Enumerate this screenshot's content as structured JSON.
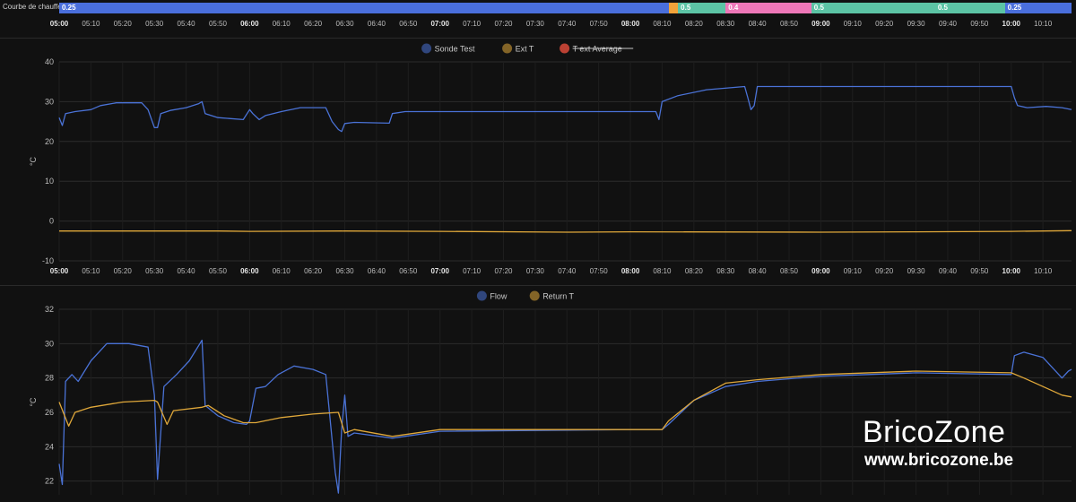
{
  "timeline": {
    "label": "Courbe de chauffe",
    "segments": [
      {
        "label": "0.25",
        "start": "05:00",
        "end": "08:12",
        "color": "#4a6fdc"
      },
      {
        "label": "",
        "start": "08:12",
        "end": "08:15",
        "color": "#f2a33a"
      },
      {
        "label": "0.5",
        "start": "08:15",
        "end": "08:30",
        "color": "#5cc4a5"
      },
      {
        "label": "0.4",
        "start": "08:30",
        "end": "08:57",
        "color": "#ee77b8"
      },
      {
        "label": "0.5",
        "start": "08:57",
        "end": "09:36",
        "color": "#5cc4a5"
      },
      {
        "label": "0.5",
        "start": "09:36",
        "end": "09:58",
        "color": "#5cc4a5"
      },
      {
        "label": "0.25",
        "start": "09:58",
        "end": "10:19",
        "color": "#4a6fdc"
      }
    ]
  },
  "time_ticks": [
    "05:00",
    "05:10",
    "05:20",
    "05:30",
    "05:40",
    "05:50",
    "06:00",
    "06:10",
    "06:20",
    "06:30",
    "06:40",
    "06:50",
    "07:00",
    "07:10",
    "07:20",
    "07:30",
    "07:40",
    "07:50",
    "08:00",
    "08:10",
    "08:20",
    "08:30",
    "08:40",
    "08:50",
    "09:00",
    "09:10",
    "09:20",
    "09:30",
    "09:40",
    "09:50",
    "10:00",
    "10:10"
  ],
  "time_ticks_major": [
    "05:00",
    "06:00",
    "07:00",
    "08:00",
    "09:00",
    "10:00"
  ],
  "watermark": {
    "title": "BricoZone",
    "url": "www.bricozone.be"
  },
  "chart_data": [
    {
      "type": "line",
      "ylabel": "°C",
      "ylim": [
        -10,
        40
      ],
      "yticks": [
        -10,
        0,
        10,
        20,
        30,
        40
      ],
      "xlim": [
        "05:00",
        "10:19"
      ],
      "grid": true,
      "legend": "top-center",
      "series": [
        {
          "name": "Sonde Test",
          "color": "#4a72d6",
          "hidden": false,
          "points": [
            [
              "05:00",
              26
            ],
            [
              "05:01",
              24
            ],
            [
              "05:02",
              27
            ],
            [
              "05:05",
              27.5
            ],
            [
              "05:10",
              28
            ],
            [
              "05:13",
              29
            ],
            [
              "05:18",
              29.7
            ],
            [
              "05:26",
              29.7
            ],
            [
              "05:28",
              28
            ],
            [
              "05:30",
              23.5
            ],
            [
              "05:31",
              23.5
            ],
            [
              "05:32",
              27
            ],
            [
              "05:35",
              27.8
            ],
            [
              "05:40",
              28.5
            ],
            [
              "05:44",
              29.5
            ],
            [
              "05:45",
              30
            ],
            [
              "05:46",
              27
            ],
            [
              "05:50",
              26
            ],
            [
              "05:58",
              25.5
            ],
            [
              "06:00",
              28
            ],
            [
              "06:01",
              27
            ],
            [
              "06:03",
              25.5
            ],
            [
              "06:05",
              26.5
            ],
            [
              "06:10",
              27.5
            ],
            [
              "06:16",
              28.5
            ],
            [
              "06:24",
              28.5
            ],
            [
              "06:26",
              25
            ],
            [
              "06:28",
              23
            ],
            [
              "06:29",
              22.5
            ],
            [
              "06:30",
              24.5
            ],
            [
              "06:33",
              24.8
            ],
            [
              "06:44",
              24.6
            ],
            [
              "06:45",
              27
            ],
            [
              "06:49",
              27.5
            ],
            [
              "08:00",
              27.5
            ],
            [
              "08:08",
              27.5
            ],
            [
              "08:09",
              25.5
            ],
            [
              "08:10",
              30
            ],
            [
              "08:15",
              31.5
            ],
            [
              "08:24",
              33
            ],
            [
              "08:36",
              33.8
            ],
            [
              "08:37",
              31
            ],
            [
              "08:38",
              28
            ],
            [
              "08:39",
              29
            ],
            [
              "08:40",
              33.8
            ],
            [
              "10:00",
              33.8
            ],
            [
              "10:01",
              31
            ],
            [
              "10:02",
              29
            ],
            [
              "10:05",
              28.5
            ],
            [
              "10:11",
              28.8
            ],
            [
              "10:16",
              28.5
            ],
            [
              "10:19",
              28
            ]
          ]
        },
        {
          "name": "Ext T",
          "color": "#e0a83a",
          "hidden": false,
          "points": [
            [
              "05:00",
              -2.5
            ],
            [
              "05:50",
              -2.5
            ],
            [
              "06:00",
              -2.6
            ],
            [
              "06:30",
              -2.5
            ],
            [
              "07:00",
              -2.6
            ],
            [
              "07:40",
              -2.8
            ],
            [
              "08:00",
              -2.7
            ],
            [
              "09:00",
              -2.8
            ],
            [
              "09:30",
              -2.7
            ],
            [
              "10:00",
              -2.6
            ],
            [
              "10:19",
              -2.4
            ]
          ]
        },
        {
          "name": "T ext Average",
          "color": "#d94a3a",
          "hidden": true,
          "points": []
        }
      ]
    },
    {
      "type": "line",
      "ylabel": "°C",
      "ylim": [
        21.2,
        32
      ],
      "yticks": [
        22,
        24,
        26,
        28,
        30,
        32
      ],
      "xlim": [
        "05:00",
        "10:19"
      ],
      "grid": true,
      "legend": "top-center",
      "series": [
        {
          "name": "Flow",
          "color": "#4a72d6",
          "points": [
            [
              "05:00",
              23
            ],
            [
              "05:01",
              21.8
            ],
            [
              "05:02",
              27.8
            ],
            [
              "05:04",
              28.2
            ],
            [
              "05:06",
              27.8
            ],
            [
              "05:10",
              29
            ],
            [
              "05:15",
              30
            ],
            [
              "05:22",
              30
            ],
            [
              "05:28",
              29.8
            ],
            [
              "05:30",
              27
            ],
            [
              "05:31",
              22.1
            ],
            [
              "05:33",
              27.5
            ],
            [
              "05:37",
              28.2
            ],
            [
              "05:41",
              29
            ],
            [
              "05:45",
              30.2
            ],
            [
              "05:46",
              26.4
            ],
            [
              "05:50",
              25.8
            ],
            [
              "05:55",
              25.4
            ],
            [
              "05:59",
              25.3
            ],
            [
              "06:00",
              25.5
            ],
            [
              "06:02",
              27.4
            ],
            [
              "06:05",
              27.5
            ],
            [
              "06:09",
              28.2
            ],
            [
              "06:14",
              28.7
            ],
            [
              "06:20",
              28.5
            ],
            [
              "06:24",
              28.2
            ],
            [
              "06:27",
              22.5
            ],
            [
              "06:28",
              21.3
            ],
            [
              "06:29",
              25
            ],
            [
              "06:30",
              27
            ],
            [
              "06:31",
              24.6
            ],
            [
              "06:33",
              24.8
            ],
            [
              "06:45",
              24.5
            ],
            [
              "07:00",
              24.9
            ],
            [
              "08:00",
              25
            ],
            [
              "08:10",
              25
            ],
            [
              "08:12",
              25.3
            ],
            [
              "08:20",
              26.7
            ],
            [
              "08:30",
              27.5
            ],
            [
              "08:40",
              27.8
            ],
            [
              "09:00",
              28.1
            ],
            [
              "09:30",
              28.3
            ],
            [
              "10:00",
              28.2
            ],
            [
              "10:01",
              29.3
            ],
            [
              "10:04",
              29.5
            ],
            [
              "10:10",
              29.2
            ],
            [
              "10:16",
              28
            ],
            [
              "10:18",
              28.4
            ],
            [
              "10:19",
              28.5
            ]
          ]
        },
        {
          "name": "Return T",
          "color": "#e0a83a",
          "points": [
            [
              "05:00",
              26.6
            ],
            [
              "05:03",
              25.2
            ],
            [
              "05:05",
              26
            ],
            [
              "05:10",
              26.3
            ],
            [
              "05:20",
              26.6
            ],
            [
              "05:30",
              26.7
            ],
            [
              "05:31",
              26.6
            ],
            [
              "05:34",
              25.3
            ],
            [
              "05:36",
              26.1
            ],
            [
              "05:45",
              26.3
            ],
            [
              "05:47",
              26.4
            ],
            [
              "05:52",
              25.8
            ],
            [
              "05:58",
              25.4
            ],
            [
              "06:02",
              25.4
            ],
            [
              "06:10",
              25.7
            ],
            [
              "06:20",
              25.9
            ],
            [
              "06:28",
              26
            ],
            [
              "06:30",
              24.8
            ],
            [
              "06:33",
              25
            ],
            [
              "06:45",
              24.6
            ],
            [
              "07:00",
              25
            ],
            [
              "08:00",
              25
            ],
            [
              "08:10",
              25
            ],
            [
              "08:12",
              25.5
            ],
            [
              "08:20",
              26.7
            ],
            [
              "08:30",
              27.7
            ],
            [
              "08:40",
              27.9
            ],
            [
              "09:00",
              28.2
            ],
            [
              "09:30",
              28.4
            ],
            [
              "10:00",
              28.3
            ],
            [
              "10:04",
              28
            ],
            [
              "10:10",
              27.5
            ],
            [
              "10:16",
              27
            ],
            [
              "10:19",
              26.9
            ]
          ]
        }
      ]
    }
  ]
}
